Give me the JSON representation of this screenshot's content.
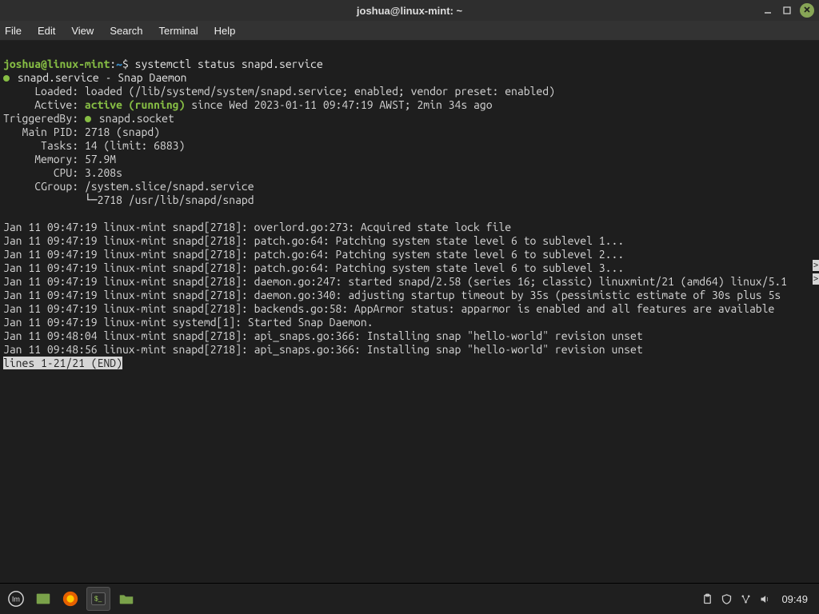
{
  "titlebar": {
    "title": "joshua@linux-mint: ~"
  },
  "menubar": {
    "items": [
      "File",
      "Edit",
      "View",
      "Search",
      "Terminal",
      "Help"
    ]
  },
  "prompt": {
    "user_host": "joshua@linux-mint",
    "colon": ":",
    "path": "~",
    "dollar": "$",
    "command": "systemctl status snapd.service"
  },
  "status": {
    "unit_line": "snapd.service - Snap Daemon",
    "loaded_label": "     Loaded: ",
    "loaded_value": "loaded (/lib/systemd/system/snapd.service; enabled; vendor preset: enabled)",
    "active_label": "     Active: ",
    "active_state": "active (running)",
    "active_since": " since Wed 2023-01-11 09:47:19 AWST; 2min 34s ago",
    "triggeredby_label": "TriggeredBy: ",
    "triggeredby_value": " snapd.socket",
    "mainpid_label": "   Main PID: ",
    "mainpid_value": "2718 (snapd)",
    "tasks_label": "      Tasks: ",
    "tasks_value": "14 (limit: 6883)",
    "memory_label": "     Memory: ",
    "memory_value": "57.9M",
    "cpu_label": "        CPU: ",
    "cpu_value": "3.208s",
    "cgroup_label": "     CGroup: ",
    "cgroup_value": "/system.slice/snapd.service",
    "cgroup_child": "             └─2718 /usr/lib/snapd/snapd"
  },
  "log_lines": [
    "Jan 11 09:47:19 linux-mint snapd[2718]: overlord.go:273: Acquired state lock file",
    "Jan 11 09:47:19 linux-mint snapd[2718]: patch.go:64: Patching system state level 6 to sublevel 1...",
    "Jan 11 09:47:19 linux-mint snapd[2718]: patch.go:64: Patching system state level 6 to sublevel 2...",
    "Jan 11 09:47:19 linux-mint snapd[2718]: patch.go:64: Patching system state level 6 to sublevel 3...",
    "Jan 11 09:47:19 linux-mint snapd[2718]: daemon.go:247: started snapd/2.58 (series 16; classic) linuxmint/21 (amd64) linux/5.1",
    "Jan 11 09:47:19 linux-mint snapd[2718]: daemon.go:340: adjusting startup timeout by 35s (pessimistic estimate of 30s plus 5s ",
    "Jan 11 09:47:19 linux-mint snapd[2718]: backends.go:58: AppArmor status: apparmor is enabled and all features are available",
    "Jan 11 09:47:19 linux-mint systemd[1]: Started Snap Daemon.",
    "Jan 11 09:48:04 linux-mint snapd[2718]: api_snaps.go:366: Installing snap \"hello-world\" revision unset",
    "Jan 11 09:48:56 linux-mint snapd[2718]: api_snaps.go:366: Installing snap \"hello-world\" revision unset"
  ],
  "pager_tail": "lines 1-21/21 (END)",
  "scroll_glyph": ">",
  "taskbar": {
    "clock": "09:49",
    "tray_icons": [
      "clipboard-icon",
      "shield-icon",
      "network-icon",
      "volume-icon"
    ]
  }
}
